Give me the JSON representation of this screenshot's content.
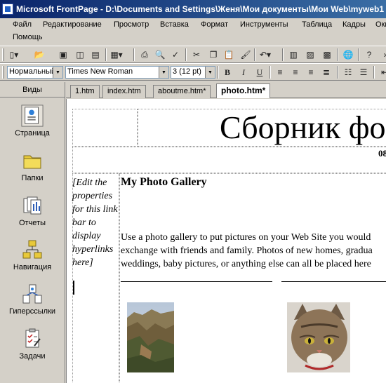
{
  "window": {
    "title": "Microsoft FrontPage - D:\\Documents and Settings\\Женя\\Мои документы\\Мои Web\\myweb1"
  },
  "menu": {
    "items": [
      "Файл",
      "Редактирование",
      "Просмотр",
      "Вставка",
      "Формат",
      "Инструменты",
      "Таблица",
      "Кадры",
      "Окно",
      "Помощь"
    ]
  },
  "format_bar": {
    "style_value": "Нормальный",
    "font_value": "Times New Roman",
    "size_value": "3  (12 pt)"
  },
  "views": {
    "header": "Виды",
    "items": [
      "Страница",
      "Папки",
      "Отчеты",
      "Навигация",
      "Гиперссылки",
      "Задачи"
    ]
  },
  "tabs": [
    "1.htm",
    "index.htm",
    "aboutme.htm*",
    "photo.htm*"
  ],
  "document": {
    "banner": "Сборник фо",
    "small_number": "08",
    "linkbar_text": "[Edit the properties for this link bar to display hyperlinks here]",
    "gallery_title": "My Photo Gallery",
    "description_lines": [
      "Use a photo gallery to put pictures on your Web Site you would",
      "exchange with friends and family. Photos of new homes, gradua",
      "weddings, baby pictures, or anything else can all be placed here"
    ]
  },
  "colors": {
    "titlebar_start": "#0a246a",
    "titlebar_end": "#3a6ea5",
    "chrome": "#d4d0c8"
  }
}
